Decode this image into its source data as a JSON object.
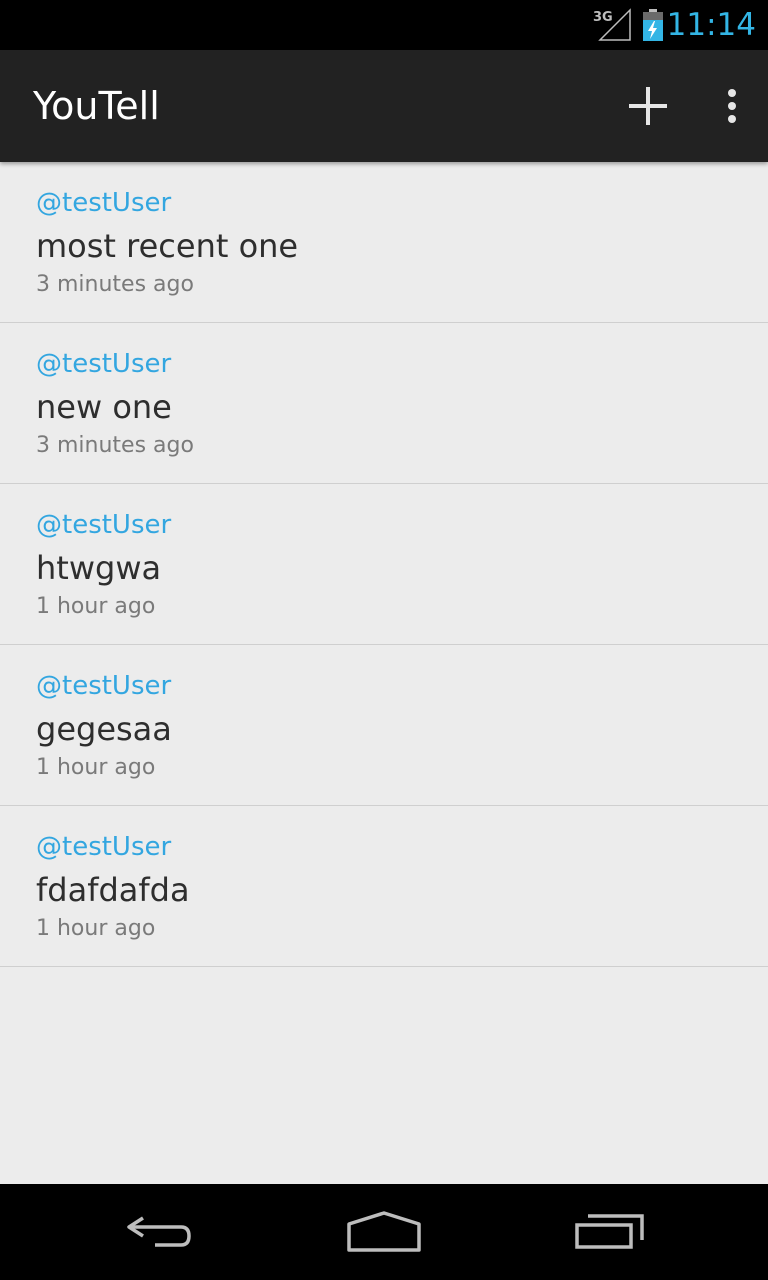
{
  "status_bar": {
    "network": "3G",
    "network_icon": "signal-3g-icon",
    "battery_icon": "battery-charging-icon",
    "clock": "11:14",
    "clock_color": "#33b5e5"
  },
  "action_bar": {
    "title": "YouTell",
    "add_icon": "plus-icon",
    "overflow_icon": "overflow-menu-icon"
  },
  "posts": [
    {
      "user": "@testUser",
      "message": "most recent one",
      "time": "3 minutes ago"
    },
    {
      "user": "@testUser",
      "message": "new one",
      "time": "3 minutes ago"
    },
    {
      "user": "@testUser",
      "message": "htwgwa",
      "time": "1 hour ago"
    },
    {
      "user": "@testUser",
      "message": "gegesaa",
      "time": "1 hour ago"
    },
    {
      "user": "@testUser",
      "message": "fdafdafda",
      "time": "1 hour ago"
    }
  ],
  "nav_bar": {
    "back_icon": "back-icon",
    "home_icon": "home-icon",
    "recents_icon": "recents-icon"
  },
  "colors": {
    "accent": "#33a6e0",
    "background": "#ececec",
    "action_bar": "#222222"
  }
}
